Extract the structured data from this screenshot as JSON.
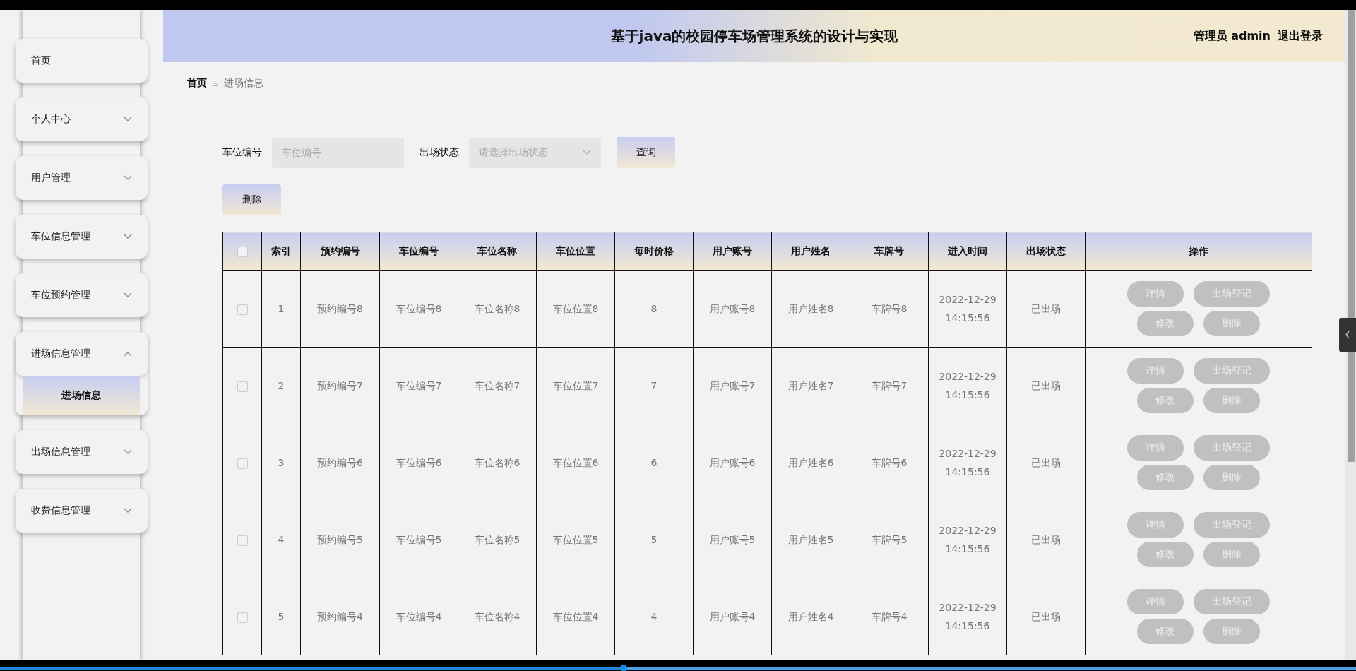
{
  "header": {
    "title": "基于java的校园停车场管理系统的设计与实现",
    "user": "管理员 admin",
    "logout": "退出登录"
  },
  "sidebar": {
    "items": [
      {
        "label": "首页",
        "kind": "link"
      },
      {
        "label": "个人中心",
        "kind": "menu",
        "expanded": false
      },
      {
        "label": "用户管理",
        "kind": "menu",
        "expanded": false
      },
      {
        "label": "车位信息管理",
        "kind": "menu",
        "expanded": false
      },
      {
        "label": "车位预约管理",
        "kind": "menu",
        "expanded": false
      },
      {
        "label": "进场信息管理",
        "kind": "menu",
        "expanded": true,
        "children": [
          {
            "label": "进场信息",
            "selected": true
          }
        ]
      },
      {
        "label": "出场信息管理",
        "kind": "menu",
        "expanded": false
      },
      {
        "label": "收费信息管理",
        "kind": "menu",
        "expanded": false
      }
    ]
  },
  "breadcrumb": [
    "首页",
    "进场信息"
  ],
  "filters": [
    {
      "label": "车位编号",
      "kind": "input",
      "placeholder": "车位编号"
    },
    {
      "label": "出场状态",
      "kind": "select",
      "placeholder": "请选择出场状态"
    }
  ],
  "search_button": "查询",
  "delete_button": "删除",
  "table": {
    "header_checked": false,
    "columns": [
      "索引",
      "预约编号",
      "车位编号",
      "车位名称",
      "车位位置",
      "每时价格",
      "用户账号",
      "用户姓名",
      "车牌号",
      "进入时间",
      "出场状态",
      "操作"
    ],
    "rows": [
      {
        "checked": false,
        "cells": [
          "1",
          "预约编号8",
          "车位编号8",
          "车位名称8",
          "车位位置8",
          "8",
          "用户账号8",
          "用户姓名8",
          "车牌号8",
          "2022-12-29 14:15:56",
          "已出场"
        ],
        "actions": [
          "详情",
          "出场登记",
          "修改",
          "删除"
        ]
      },
      {
        "checked": false,
        "cells": [
          "2",
          "预约编号7",
          "车位编号7",
          "车位名称7",
          "车位位置7",
          "7",
          "用户账号7",
          "用户姓名7",
          "车牌号7",
          "2022-12-29 14:15:56",
          "已出场"
        ],
        "actions": [
          "详情",
          "出场登记",
          "修改",
          "删除"
        ]
      },
      {
        "checked": false,
        "cells": [
          "3",
          "预约编号6",
          "车位编号6",
          "车位名称6",
          "车位位置6",
          "6",
          "用户账号6",
          "用户姓名6",
          "车牌号6",
          "2022-12-29 14:15:56",
          "已出场"
        ],
        "actions": [
          "详情",
          "出场登记",
          "修改",
          "删除"
        ]
      },
      {
        "checked": false,
        "cells": [
          "4",
          "预约编号5",
          "车位编号5",
          "车位名称5",
          "车位位置5",
          "5",
          "用户账号5",
          "用户姓名5",
          "车牌号5",
          "2022-12-29 14:15:56",
          "已出场"
        ],
        "actions": [
          "详情",
          "出场登记",
          "修改",
          "删除"
        ]
      },
      {
        "checked": false,
        "cells": [
          "5",
          "预约编号4",
          "车位编号4",
          "车位名称4",
          "车位位置4",
          "4",
          "用户账号4",
          "用户姓名4",
          "车牌号4",
          "2022-12-29 14:15:56",
          "已出场"
        ],
        "actions": [
          "详情",
          "出场登记",
          "修改",
          "删除"
        ]
      }
    ]
  },
  "playback": {
    "level": 0.46
  }
}
